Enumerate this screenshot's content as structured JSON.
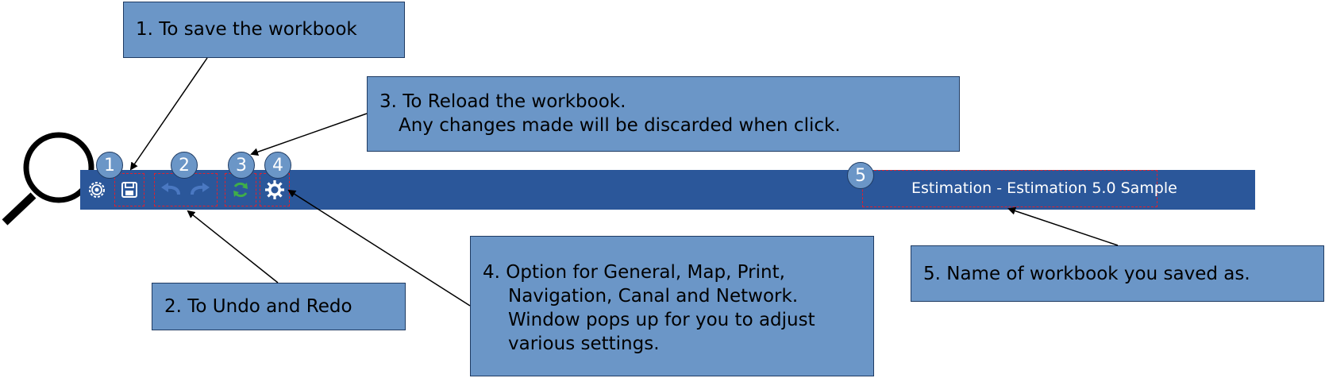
{
  "toolbar": {
    "background": "#2b579a",
    "workbook_title": "Estimation - Estimation 5.0 Sample",
    "icons": {
      "app": "app-gear-icon",
      "save": "save-icon",
      "undo": "undo-icon",
      "redo": "redo-icon",
      "reload": "reload-icon",
      "options": "settings-gear-icon"
    }
  },
  "badges": {
    "save": "1",
    "undo_redo": "2",
    "reload": "3",
    "options": "4",
    "title": "5"
  },
  "callouts": {
    "save": "1. To save the workbook",
    "undo_redo": "2.  To Undo and Redo",
    "reload": {
      "line1": "3. To Reload the workbook.",
      "line2": "Any changes made will be discarded when click."
    },
    "options": {
      "line1": "4.  Option for General, Map, Print,",
      "line2": "Navigation, Canal and Network.",
      "line3": "Window pops up for you to adjust",
      "line4": "various settings."
    },
    "title": "5.  Name of workbook you saved as."
  },
  "colors": {
    "callout_fill": "#6b96c7",
    "callout_border": "#1f3b63",
    "highlight_dash": "#e0202e",
    "reload_green": "#3fae49"
  },
  "decorations": {
    "magnifier": "magnifier-icon"
  }
}
